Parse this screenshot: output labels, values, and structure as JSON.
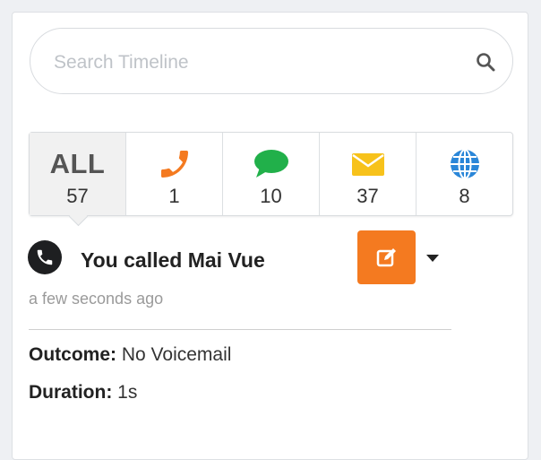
{
  "search": {
    "placeholder": "Search Timeline"
  },
  "filters": [
    {
      "label": "ALL",
      "count": "57",
      "icon": "all",
      "active": true
    },
    {
      "icon": "phone-icon",
      "color": "#f47a20",
      "count": "1"
    },
    {
      "icon": "chat-bubble-icon",
      "color": "#21b04a",
      "count": "10"
    },
    {
      "icon": "envelope-icon",
      "color": "#f7c21b",
      "count": "37"
    },
    {
      "icon": "globe-icon",
      "color": "#2a86d8",
      "count": "8"
    }
  ],
  "event": {
    "icon": "phone-icon",
    "title": "You called Mai Vue",
    "timestamp": "a few seconds ago",
    "edit_icon": "edit-icon",
    "accent": "#f47a20",
    "outcome_label": "Outcome:",
    "outcome_value": "No Voicemail",
    "duration_label": "Duration:",
    "duration_value": "1s"
  }
}
